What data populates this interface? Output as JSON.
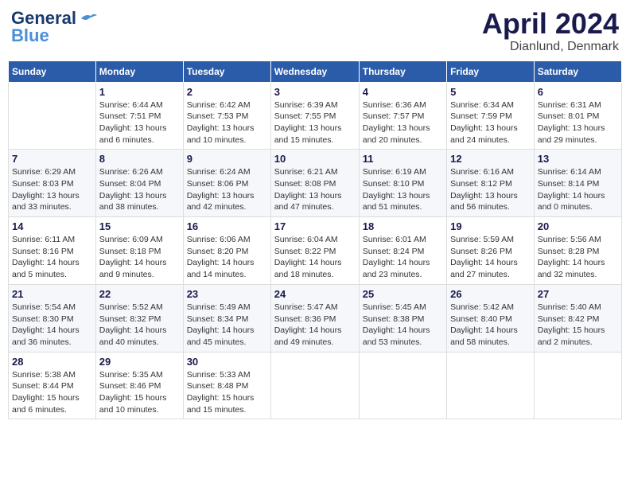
{
  "header": {
    "logo_line1": "General",
    "logo_line2": "Blue",
    "month": "April 2024",
    "location": "Dianlund, Denmark"
  },
  "weekdays": [
    "Sunday",
    "Monday",
    "Tuesday",
    "Wednesday",
    "Thursday",
    "Friday",
    "Saturday"
  ],
  "weeks": [
    [
      {
        "day": "",
        "sunrise": "",
        "sunset": "",
        "daylight": ""
      },
      {
        "day": "1",
        "sunrise": "Sunrise: 6:44 AM",
        "sunset": "Sunset: 7:51 PM",
        "daylight": "Daylight: 13 hours and 6 minutes."
      },
      {
        "day": "2",
        "sunrise": "Sunrise: 6:42 AM",
        "sunset": "Sunset: 7:53 PM",
        "daylight": "Daylight: 13 hours and 10 minutes."
      },
      {
        "day": "3",
        "sunrise": "Sunrise: 6:39 AM",
        "sunset": "Sunset: 7:55 PM",
        "daylight": "Daylight: 13 hours and 15 minutes."
      },
      {
        "day": "4",
        "sunrise": "Sunrise: 6:36 AM",
        "sunset": "Sunset: 7:57 PM",
        "daylight": "Daylight: 13 hours and 20 minutes."
      },
      {
        "day": "5",
        "sunrise": "Sunrise: 6:34 AM",
        "sunset": "Sunset: 7:59 PM",
        "daylight": "Daylight: 13 hours and 24 minutes."
      },
      {
        "day": "6",
        "sunrise": "Sunrise: 6:31 AM",
        "sunset": "Sunset: 8:01 PM",
        "daylight": "Daylight: 13 hours and 29 minutes."
      }
    ],
    [
      {
        "day": "7",
        "sunrise": "Sunrise: 6:29 AM",
        "sunset": "Sunset: 8:03 PM",
        "daylight": "Daylight: 13 hours and 33 minutes."
      },
      {
        "day": "8",
        "sunrise": "Sunrise: 6:26 AM",
        "sunset": "Sunset: 8:04 PM",
        "daylight": "Daylight: 13 hours and 38 minutes."
      },
      {
        "day": "9",
        "sunrise": "Sunrise: 6:24 AM",
        "sunset": "Sunset: 8:06 PM",
        "daylight": "Daylight: 13 hours and 42 minutes."
      },
      {
        "day": "10",
        "sunrise": "Sunrise: 6:21 AM",
        "sunset": "Sunset: 8:08 PM",
        "daylight": "Daylight: 13 hours and 47 minutes."
      },
      {
        "day": "11",
        "sunrise": "Sunrise: 6:19 AM",
        "sunset": "Sunset: 8:10 PM",
        "daylight": "Daylight: 13 hours and 51 minutes."
      },
      {
        "day": "12",
        "sunrise": "Sunrise: 6:16 AM",
        "sunset": "Sunset: 8:12 PM",
        "daylight": "Daylight: 13 hours and 56 minutes."
      },
      {
        "day": "13",
        "sunrise": "Sunrise: 6:14 AM",
        "sunset": "Sunset: 8:14 PM",
        "daylight": "Daylight: 14 hours and 0 minutes."
      }
    ],
    [
      {
        "day": "14",
        "sunrise": "Sunrise: 6:11 AM",
        "sunset": "Sunset: 8:16 PM",
        "daylight": "Daylight: 14 hours and 5 minutes."
      },
      {
        "day": "15",
        "sunrise": "Sunrise: 6:09 AM",
        "sunset": "Sunset: 8:18 PM",
        "daylight": "Daylight: 14 hours and 9 minutes."
      },
      {
        "day": "16",
        "sunrise": "Sunrise: 6:06 AM",
        "sunset": "Sunset: 8:20 PM",
        "daylight": "Daylight: 14 hours and 14 minutes."
      },
      {
        "day": "17",
        "sunrise": "Sunrise: 6:04 AM",
        "sunset": "Sunset: 8:22 PM",
        "daylight": "Daylight: 14 hours and 18 minutes."
      },
      {
        "day": "18",
        "sunrise": "Sunrise: 6:01 AM",
        "sunset": "Sunset: 8:24 PM",
        "daylight": "Daylight: 14 hours and 23 minutes."
      },
      {
        "day": "19",
        "sunrise": "Sunrise: 5:59 AM",
        "sunset": "Sunset: 8:26 PM",
        "daylight": "Daylight: 14 hours and 27 minutes."
      },
      {
        "day": "20",
        "sunrise": "Sunrise: 5:56 AM",
        "sunset": "Sunset: 8:28 PM",
        "daylight": "Daylight: 14 hours and 32 minutes."
      }
    ],
    [
      {
        "day": "21",
        "sunrise": "Sunrise: 5:54 AM",
        "sunset": "Sunset: 8:30 PM",
        "daylight": "Daylight: 14 hours and 36 minutes."
      },
      {
        "day": "22",
        "sunrise": "Sunrise: 5:52 AM",
        "sunset": "Sunset: 8:32 PM",
        "daylight": "Daylight: 14 hours and 40 minutes."
      },
      {
        "day": "23",
        "sunrise": "Sunrise: 5:49 AM",
        "sunset": "Sunset: 8:34 PM",
        "daylight": "Daylight: 14 hours and 45 minutes."
      },
      {
        "day": "24",
        "sunrise": "Sunrise: 5:47 AM",
        "sunset": "Sunset: 8:36 PM",
        "daylight": "Daylight: 14 hours and 49 minutes."
      },
      {
        "day": "25",
        "sunrise": "Sunrise: 5:45 AM",
        "sunset": "Sunset: 8:38 PM",
        "daylight": "Daylight: 14 hours and 53 minutes."
      },
      {
        "day": "26",
        "sunrise": "Sunrise: 5:42 AM",
        "sunset": "Sunset: 8:40 PM",
        "daylight": "Daylight: 14 hours and 58 minutes."
      },
      {
        "day": "27",
        "sunrise": "Sunrise: 5:40 AM",
        "sunset": "Sunset: 8:42 PM",
        "daylight": "Daylight: 15 hours and 2 minutes."
      }
    ],
    [
      {
        "day": "28",
        "sunrise": "Sunrise: 5:38 AM",
        "sunset": "Sunset: 8:44 PM",
        "daylight": "Daylight: 15 hours and 6 minutes."
      },
      {
        "day": "29",
        "sunrise": "Sunrise: 5:35 AM",
        "sunset": "Sunset: 8:46 PM",
        "daylight": "Daylight: 15 hours and 10 minutes."
      },
      {
        "day": "30",
        "sunrise": "Sunrise: 5:33 AM",
        "sunset": "Sunset: 8:48 PM",
        "daylight": "Daylight: 15 hours and 15 minutes."
      },
      {
        "day": "",
        "sunrise": "",
        "sunset": "",
        "daylight": ""
      },
      {
        "day": "",
        "sunrise": "",
        "sunset": "",
        "daylight": ""
      },
      {
        "day": "",
        "sunrise": "",
        "sunset": "",
        "daylight": ""
      },
      {
        "day": "",
        "sunrise": "",
        "sunset": "",
        "daylight": ""
      }
    ]
  ]
}
